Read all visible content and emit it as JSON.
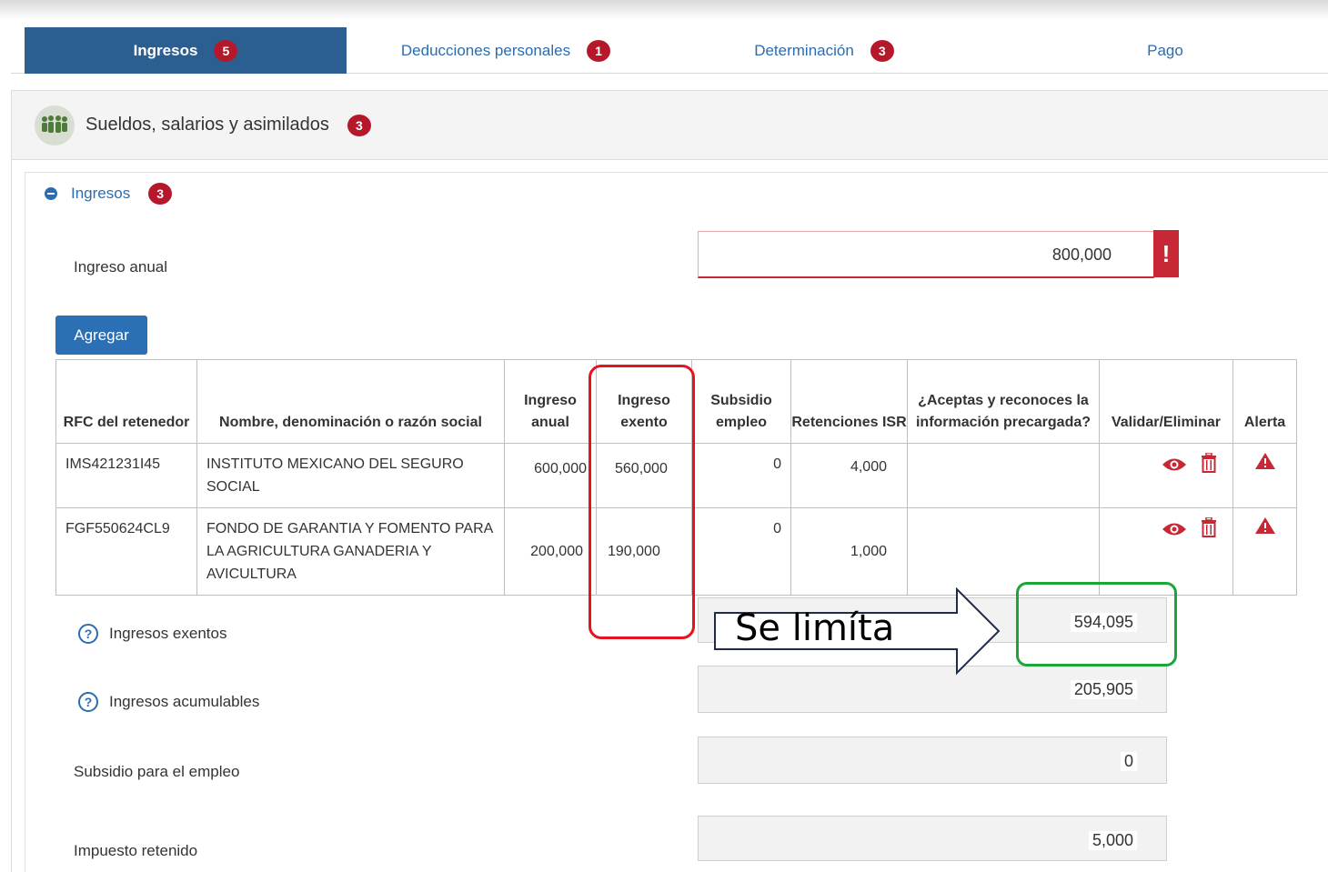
{
  "tabs": [
    {
      "label": "Ingresos",
      "badge": "5",
      "active": true
    },
    {
      "label": "Deducciones personales",
      "badge": "1",
      "active": false
    },
    {
      "label": "Determinación",
      "badge": "3",
      "active": false
    },
    {
      "label": "Pago",
      "badge": "",
      "active": false
    }
  ],
  "section": {
    "title": "Sueldos, salarios y asimilados",
    "badge": "3",
    "icon": "people-icon"
  },
  "subsection": {
    "label": "Ingresos",
    "badge": "3"
  },
  "ingreso_anual": {
    "label": "Ingreso anual",
    "value": "800,000",
    "error_mark": "!"
  },
  "add_button": "Agregar",
  "table": {
    "headers": [
      "RFC del retenedor",
      "Nombre, denominación o razón social",
      "Ingreso anual",
      "Ingreso exento",
      "Subsidio empleo",
      "Retenciones ISR",
      "¿Aceptas y reconoces la información precargada?",
      "Validar/Eliminar",
      "Alerta"
    ],
    "rows": [
      {
        "rfc": "IMS421231I45",
        "nombre": "INSTITUTO MEXICANO DEL SEGURO SOCIAL",
        "ingreso_anual": "600,000",
        "ingreso_exento": "560,000",
        "subsidio": "0",
        "retenciones": "4,000"
      },
      {
        "rfc": "FGF550624CL9",
        "nombre": "FONDO DE GARANTIA Y FOMENTO PARA LA AGRICULTURA GANADERIA Y AVICULTURA",
        "ingreso_anual": "200,000",
        "ingreso_exento": "190,000",
        "subsidio": "0",
        "retenciones": "1,000"
      }
    ]
  },
  "summary": {
    "exentos": {
      "label": "Ingresos exentos",
      "value": "594,095",
      "help": "?"
    },
    "acumulables": {
      "label": "Ingresos acumulables",
      "value": "205,905",
      "help": "?"
    },
    "subsidio": {
      "label": "Subsidio para el empleo",
      "value": "0"
    },
    "impuesto": {
      "label": "Impuesto retenido",
      "value": "5,000"
    }
  },
  "annotation": {
    "text": "Se limíta"
  },
  "colors": {
    "accent": "#2b5f91",
    "badge": "#b5182b",
    "error": "#c62836",
    "annotation_red": "#e3141f",
    "annotation_green": "#1aa639"
  }
}
